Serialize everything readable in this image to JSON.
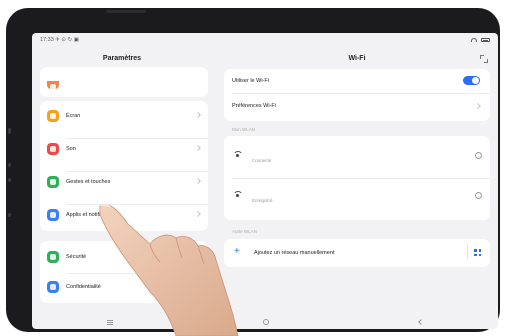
{
  "status": {
    "time": "17:33 ✈ ⊙ ↻ ▣"
  },
  "left": {
    "title": "Paramètres",
    "group1": [
      {
        "label": "Écran",
        "icon": "display-icon",
        "color": "#f4a21d"
      },
      {
        "label": "Son",
        "icon": "sound-icon",
        "color": "#ea4b4b"
      },
      {
        "label": "Gestes et touches",
        "icon": "gesture-icon",
        "color": "#2fae5b"
      },
      {
        "label": "Applis et notifications",
        "icon": "apps-icon",
        "color": "#3a7ff2"
      }
    ],
    "group2": [
      {
        "label": "Sécurité",
        "icon": "shield-icon",
        "color": "#2fae5b"
      },
      {
        "label": "Confidentialité",
        "icon": "privacy-icon",
        "color": "#3a7ff2"
      }
    ]
  },
  "right": {
    "title": "Wi-Fi",
    "use_wifi": "Utiliser le Wi-Fi",
    "wifi_prefs": "Préférences Wi-Fi",
    "my_wlan_label": "Mon WLAN",
    "networks": [
      {
        "status": "Connecté"
      },
      {
        "status": "Enregistré"
      }
    ],
    "other_wlan_label": "Autre WLAN",
    "add_network": "Ajoutez un réseau manuellement"
  },
  "colors": {
    "accent": "#2a6ef2",
    "background": "#f2f2f4"
  }
}
